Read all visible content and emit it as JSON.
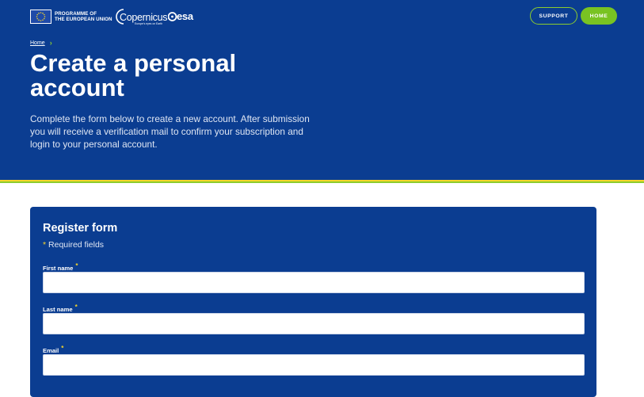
{
  "header": {
    "eu_logo_text_line1": "PROGRAMME OF",
    "eu_logo_text_line2": "THE EUROPEAN UNION",
    "copernicus_logo": "Copernicus",
    "copernicus_tagline": "Europe's eyes on Earth",
    "esa_logo": "esa",
    "support_label": "SUPPORT",
    "home_label": "HOME"
  },
  "breadcrumb": {
    "home": "Home",
    "separator_icon": "chevron-right-icon"
  },
  "hero": {
    "title": "Create a personal account",
    "intro": "Complete the form below to create a new account. After submission you will receive a verification mail to confirm your subscription and login to your personal account."
  },
  "form": {
    "title": "Register form",
    "required_mark": "*",
    "required_note": "Required fields",
    "fields": [
      {
        "label": "First name",
        "value": "",
        "placeholder": ""
      },
      {
        "label": "Last name",
        "value": "",
        "placeholder": ""
      },
      {
        "label": "Email",
        "value": "",
        "placeholder": ""
      }
    ]
  },
  "colors": {
    "brand_blue": "#0b3d91",
    "accent_green": "#79c322",
    "accent_yellow": "#f5d42a"
  }
}
